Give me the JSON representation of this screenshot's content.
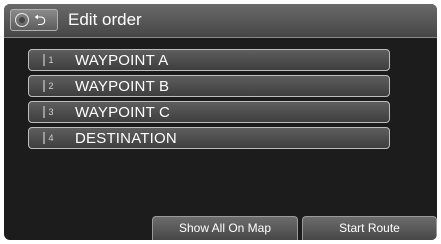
{
  "header": {
    "title": "Edit order",
    "nav_icon": "map-nav-icon",
    "back_icon": "back-arrow-icon",
    "back_glyph": "⮌"
  },
  "route_points": [
    {
      "number": "1",
      "label": "WAYPOINT A"
    },
    {
      "number": "2",
      "label": "WAYPOINT B"
    },
    {
      "number": "3",
      "label": "WAYPOINT C"
    },
    {
      "number": "4",
      "label": "DESTINATION"
    }
  ],
  "footer": {
    "show_all_label": "Show All On Map",
    "start_route_label": "Start Route"
  },
  "colors": {
    "background": "#1c1c1c",
    "header": "#545454",
    "row_border": "#bdbdbd",
    "text": "#ffffff"
  }
}
